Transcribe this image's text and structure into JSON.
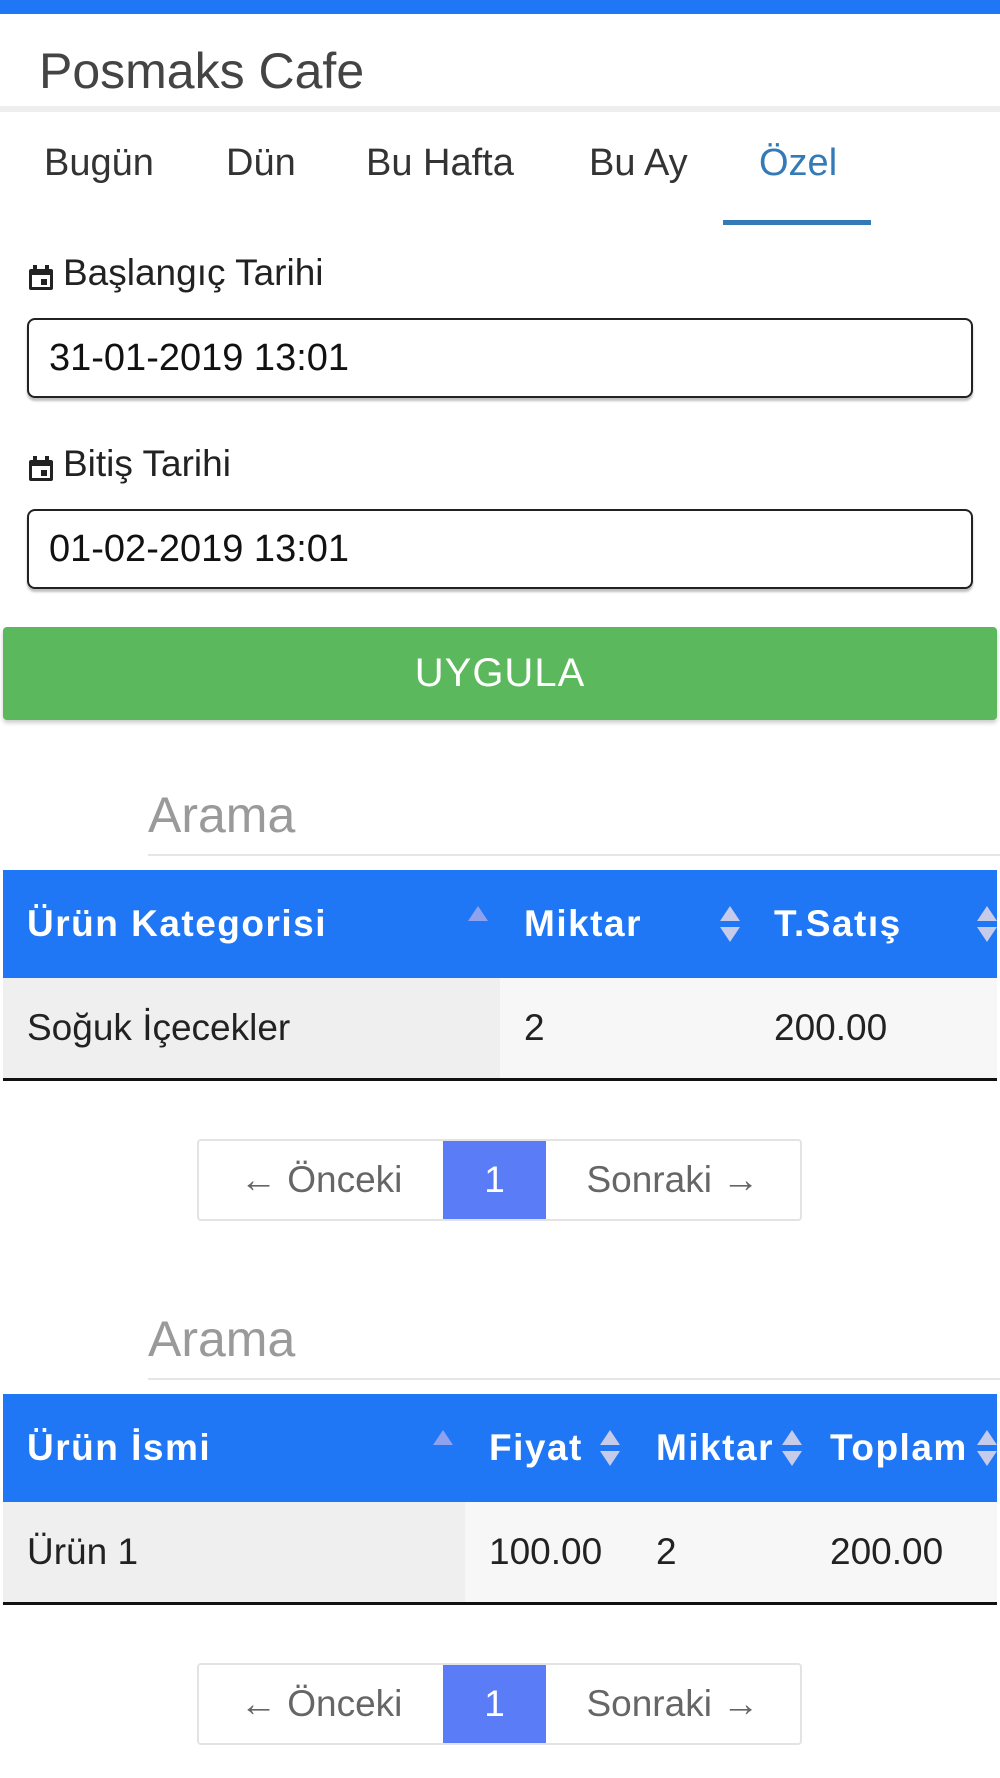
{
  "app": {
    "title": "Posmaks Cafe"
  },
  "tabs": [
    {
      "label": "Bugün"
    },
    {
      "label": "Dün"
    },
    {
      "label": "Bu Hafta"
    },
    {
      "label": "Bu Ay"
    },
    {
      "label": "Özel",
      "active": true
    }
  ],
  "filters": {
    "start_label": "Başlangıç Tarihi",
    "start_value": "31-01-2019 13:01",
    "end_label": "Bitiş Tarihi",
    "end_value": "01-02-2019 13:01",
    "apply_label": "UYGULA"
  },
  "category_table": {
    "search_placeholder": "Arama",
    "columns": [
      "Ürün Kategorisi",
      "Miktar",
      "T.Satış"
    ],
    "rows": [
      [
        "Soğuk İçecekler",
        "2",
        "200.00"
      ]
    ],
    "pagination": {
      "prev": "← Önceki",
      "page": "1",
      "next": "Sonraki →"
    }
  },
  "product_table": {
    "search_placeholder": "Arama",
    "columns": [
      "Ürün İsmi",
      "Fiyat",
      "Miktar",
      "Toplam"
    ],
    "rows": [
      [
        "Ürün 1",
        "100.00",
        "2",
        "200.00"
      ]
    ],
    "pagination": {
      "prev": "← Önceki",
      "page": "1",
      "next": "Sonraki →"
    }
  },
  "colors": {
    "header_blue": "#1f77f5",
    "tab_active": "#337ab7",
    "apply_green": "#5cb85c",
    "page_active": "#5b7cf7"
  },
  "icons": {
    "date_label": "calendar-icon",
    "sort": "sort-arrows-icon"
  }
}
